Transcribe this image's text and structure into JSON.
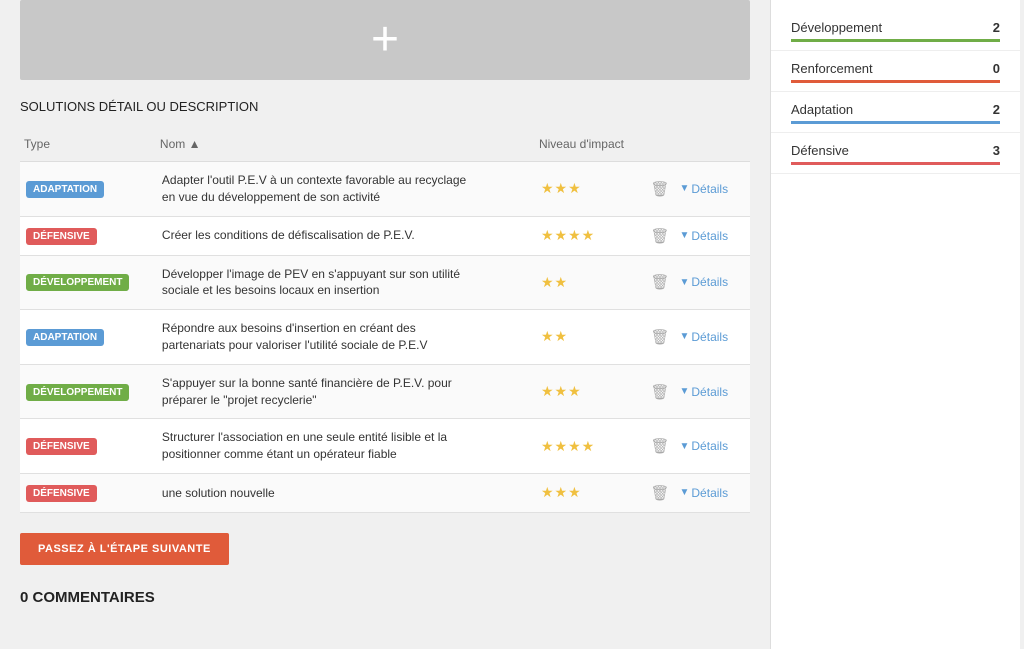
{
  "addButton": {
    "icon": "+"
  },
  "sectionTitle": "SOLUTIONS",
  "sectionSubtitle": " DÉTAIL OU DESCRIPTION",
  "tableHeaders": {
    "type": "Type",
    "nom": "Nom ▲",
    "niveauImpact": "Niveau d'impact"
  },
  "rows": [
    {
      "type": "ADAPTATION",
      "badgeClass": "badge-adaptation",
      "nom": "Adapter l'outil P.E.V à un contexte favorable au recyclage en vue du développement de son activité",
      "stars": "★★★",
      "details": "Détails"
    },
    {
      "type": "DÉFENSIVE",
      "badgeClass": "badge-defensive",
      "nom": "Créer les conditions de défiscalisation de P.E.V.",
      "stars": "★★★★",
      "details": "Détails"
    },
    {
      "type": "DÉVELOPPEMENT",
      "badgeClass": "badge-developpement",
      "nom": "Développer l'image de PEV en s'appuyant sur son utilité sociale et les besoins locaux en insertion",
      "stars": "★★",
      "details": "Détails"
    },
    {
      "type": "ADAPTATION",
      "badgeClass": "badge-adaptation",
      "nom": "Répondre aux besoins d'insertion en créant des partenariats pour valoriser l'utilité sociale de P.E.V",
      "stars": "★★",
      "details": "Détails"
    },
    {
      "type": "DÉVELOPPEMENT",
      "badgeClass": "badge-developpement",
      "nom": "S'appuyer sur la bonne santé financière de P.E.V. pour préparer le \"projet recyclerie\"",
      "stars": "★★★",
      "details": "Détails"
    },
    {
      "type": "DÉFENSIVE",
      "badgeClass": "badge-defensive",
      "nom": "Structurer l'association en une seule entité lisible et la positionner comme étant un opérateur fiable",
      "stars": "★★★★",
      "details": "Détails"
    },
    {
      "type": "DÉFENSIVE",
      "badgeClass": "badge-defensive",
      "nom": "une solution nouvelle",
      "stars": "★★★",
      "details": "Détails"
    }
  ],
  "nextButton": "PASSEZ À L'ÉTAPE SUIVANTE",
  "commentsTitle": "0 COMMENTAIRES",
  "sidebar": {
    "items": [
      {
        "label": "Développement",
        "count": "2",
        "barClass": "bar-green"
      },
      {
        "label": "Renforcement",
        "count": "0",
        "barClass": "bar-orange"
      },
      {
        "label": "Adaptation",
        "count": "2",
        "barClass": "bar-blue"
      },
      {
        "label": "Défensive",
        "count": "3",
        "barClass": "bar-red"
      }
    ]
  }
}
